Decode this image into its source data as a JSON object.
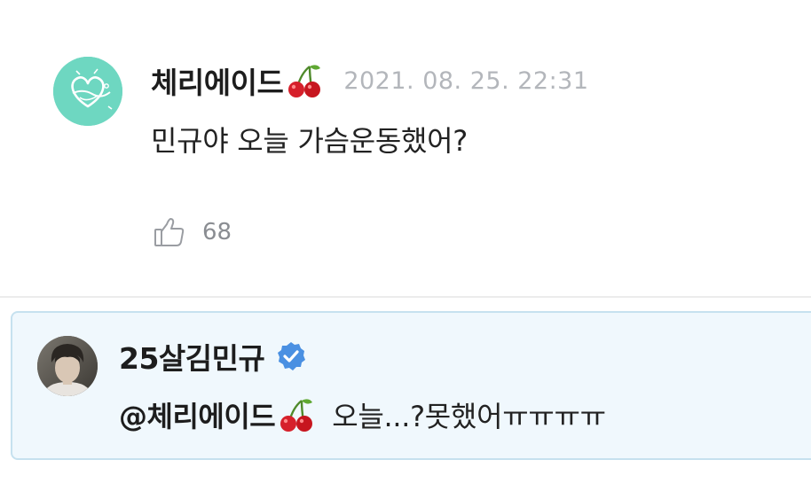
{
  "comment": {
    "username": "체리에이드",
    "timestamp": "2021. 08. 25. 22:31",
    "text": "민규야 오늘 가슴운동했어?",
    "like_count": "68",
    "username_emoji_icon": "cherry-icon",
    "avatar_icon": "heart-doodle-avatar",
    "like_icon": "thumbs-up-icon"
  },
  "reply": {
    "username": "25살김민규",
    "verified_icon": "verified-badge-icon",
    "mention": "@체리에이드",
    "mention_emoji_icon": "cherry-icon",
    "text": "오늘...?못했어ㅠㅠㅠㅠ",
    "avatar_icon": "profile-photo-avatar"
  },
  "colors": {
    "avatar_mint": "#6ed7c1",
    "verified_blue": "#4a90e2",
    "reply_bg": "#f0f8fd",
    "reply_border": "#c6e1ef",
    "timestamp_gray": "#b3b6bb"
  }
}
